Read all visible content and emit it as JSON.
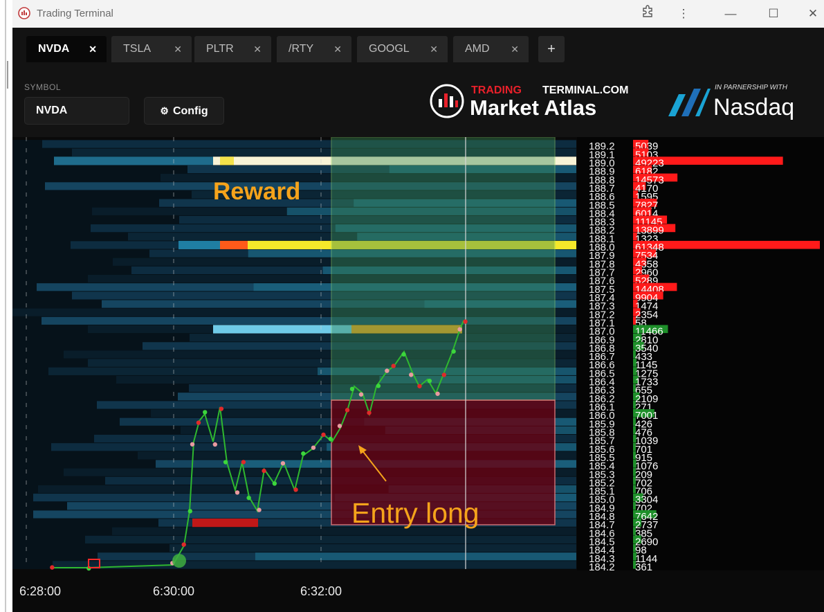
{
  "window": {
    "title": "Trading Terminal"
  },
  "tabs": [
    {
      "label": "NVDA",
      "close": "✕",
      "active": true
    },
    {
      "label": "TSLA",
      "close": "✕"
    },
    {
      "label": "PLTR",
      "close": "✕"
    },
    {
      "label": "/RTY",
      "close": "✕"
    },
    {
      "label": "GOOGL",
      "close": "✕"
    },
    {
      "label": "AMD",
      "close": "✕"
    }
  ],
  "add_tab": "+",
  "symbol": {
    "label": "SYMBOL",
    "value": "NVDA"
  },
  "config_button": "Config",
  "branding": {
    "brand_prefix": "TRADING",
    "brand_suffix": "TERMINAL.COM",
    "product": "Market Atlas",
    "partner_note": "IN PARNERSHIP WITH",
    "partner": "Nasdaq"
  },
  "colors": {
    "accent_red": "#e8202a",
    "annotation": "#f5a31b",
    "bid": "#1e8f2a",
    "ask": "#ff1a1a"
  },
  "annotations": {
    "reward": "Reward",
    "entry": "Entry long"
  },
  "time_axis": [
    "6:28:00",
    "6:30:00",
    "6:32:00"
  ],
  "order_book": [
    {
      "price": "189.2",
      "size": "5039",
      "side": "ask"
    },
    {
      "price": "189.1",
      "size": "5103",
      "side": "ask"
    },
    {
      "price": "189.0",
      "size": "49223",
      "side": "ask"
    },
    {
      "price": "188.9",
      "size": "6182",
      "side": "ask"
    },
    {
      "price": "188.8",
      "size": "14573",
      "side": "ask"
    },
    {
      "price": "188.7",
      "size": "4170",
      "side": "ask"
    },
    {
      "price": "188.6",
      "size": "1595",
      "side": "ask"
    },
    {
      "price": "188.5",
      "size": "7827",
      "side": "ask"
    },
    {
      "price": "188.4",
      "size": "6014",
      "side": "ask"
    },
    {
      "price": "188.3",
      "size": "11145",
      "side": "ask"
    },
    {
      "price": "188.2",
      "size": "13899",
      "side": "ask"
    },
    {
      "price": "188.1",
      "size": "1323",
      "side": "ask"
    },
    {
      "price": "188.0",
      "size": "61348",
      "side": "ask"
    },
    {
      "price": "187.9",
      "size": "7534",
      "side": "ask"
    },
    {
      "price": "187.8",
      "size": "4358",
      "side": "ask"
    },
    {
      "price": "187.7",
      "size": "2960",
      "side": "ask"
    },
    {
      "price": "187.6",
      "size": "5289",
      "side": "ask"
    },
    {
      "price": "187.5",
      "size": "14408",
      "side": "ask"
    },
    {
      "price": "187.4",
      "size": "9904",
      "side": "ask"
    },
    {
      "price": "187.3",
      "size": "1474",
      "side": "ask"
    },
    {
      "price": "187.2",
      "size": "2354",
      "side": "ask"
    },
    {
      "price": "187.1",
      "size": "58",
      "side": "ask"
    },
    {
      "price": "187.0",
      "size": "11466",
      "side": "bid"
    },
    {
      "price": "186.9",
      "size": "2810",
      "side": "bid"
    },
    {
      "price": "186.8",
      "size": "3540",
      "side": "bid"
    },
    {
      "price": "186.7",
      "size": "433",
      "side": "bid"
    },
    {
      "price": "186.6",
      "size": "1145",
      "side": "bid"
    },
    {
      "price": "186.5",
      "size": "1275",
      "side": "bid"
    },
    {
      "price": "186.4",
      "size": "1733",
      "side": "bid"
    },
    {
      "price": "186.3",
      "size": "655",
      "side": "bid"
    },
    {
      "price": "186.2",
      "size": "2109",
      "side": "bid"
    },
    {
      "price": "186.1",
      "size": "271",
      "side": "bid"
    },
    {
      "price": "186.0",
      "size": "7001",
      "side": "bid"
    },
    {
      "price": "185.9",
      "size": "426",
      "side": "bid"
    },
    {
      "price": "185.8",
      "size": "476",
      "side": "bid"
    },
    {
      "price": "185.7",
      "size": "1039",
      "side": "bid"
    },
    {
      "price": "185.6",
      "size": "701",
      "side": "bid"
    },
    {
      "price": "185.5",
      "size": "915",
      "side": "bid"
    },
    {
      "price": "185.4",
      "size": "1076",
      "side": "bid"
    },
    {
      "price": "185.3",
      "size": "209",
      "side": "bid"
    },
    {
      "price": "185.2",
      "size": "702",
      "side": "bid"
    },
    {
      "price": "185.1",
      "size": "706",
      "side": "bid"
    },
    {
      "price": "185.0",
      "size": "3304",
      "side": "bid"
    },
    {
      "price": "184.9",
      "size": "702",
      "side": "bid"
    },
    {
      "price": "184.8",
      "size": "7642",
      "side": "bid"
    },
    {
      "price": "184.7",
      "size": "2737",
      "side": "bid"
    },
    {
      "price": "184.6",
      "size": "385",
      "side": "bid"
    },
    {
      "price": "184.5",
      "size": "2690",
      "side": "bid"
    },
    {
      "price": "184.4",
      "size": "98",
      "side": "bid"
    },
    {
      "price": "184.3",
      "size": "1144",
      "side": "bid"
    },
    {
      "price": "184.2",
      "size": "361",
      "side": "bid"
    }
  ]
}
